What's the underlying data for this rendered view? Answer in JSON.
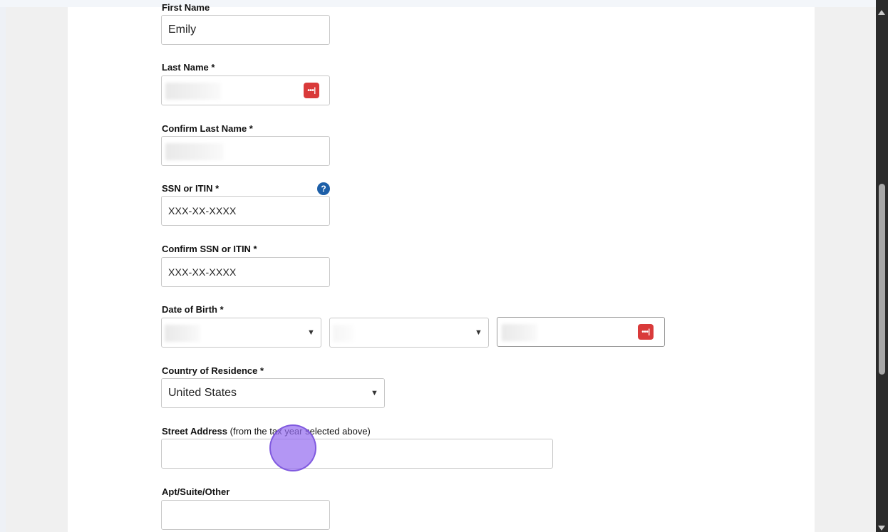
{
  "form": {
    "first_name": {
      "label": "First Name",
      "value": "Emily"
    },
    "last_name": {
      "label": "Last Name *"
    },
    "confirm_last_name": {
      "label": "Confirm Last Name *"
    },
    "ssn": {
      "label": "SSN or ITIN *",
      "value": "XXX-XX-XXXX"
    },
    "confirm_ssn": {
      "label": "Confirm SSN or ITIN *",
      "value": "XXX-XX-XXXX"
    },
    "dob": {
      "label": "Date of Birth *"
    },
    "country": {
      "label": "Country of Residence *",
      "value": "United States"
    },
    "street": {
      "label": "Street Address",
      "note": "(from the tax year selected above)"
    },
    "apt": {
      "label": "Apt/Suite/Other"
    }
  },
  "icons": {
    "password_manager": "password-manager-icon",
    "help": "help-icon",
    "dropdown": "caret-down-icon"
  },
  "glyphs": {
    "pw": "•••|",
    "help": "?",
    "caret": "▼"
  },
  "colors": {
    "password_manager": "#d93a3a",
    "help": "#1d5fa8",
    "cursor": "#966ef0"
  }
}
